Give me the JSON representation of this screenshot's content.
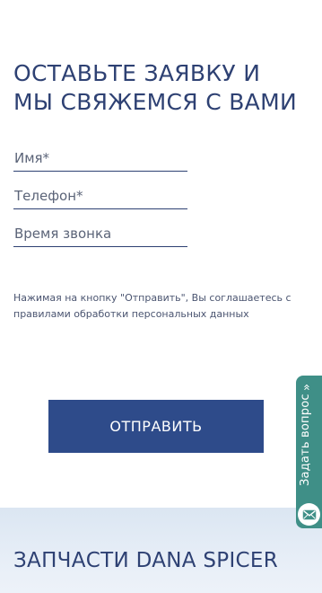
{
  "form": {
    "title": "ОСТАВЬТЕ ЗАЯВКУ И МЫ СВЯЖЕМСЯ С ВАМИ",
    "name_placeholder": "Имя*",
    "phone_placeholder": "Телефон*",
    "time_placeholder": "Время звонка",
    "consent_text": "Нажимая на кнопку \"Отправить\", Вы соглашаетесь с правилами обработки персональных данных",
    "submit_label": "ОТПРАВИТЬ"
  },
  "next_section": {
    "title": "ЗАПЧАСТИ DANA SPICER"
  },
  "ask_tab": {
    "label": "Задать вопрос",
    "chevron": "«",
    "icon": "envelope-icon"
  },
  "colors": {
    "primary": "#2e4173",
    "button": "#2e4b8a",
    "ask_tab": "#3f8f87",
    "section_bg": "#dbe6f2"
  }
}
